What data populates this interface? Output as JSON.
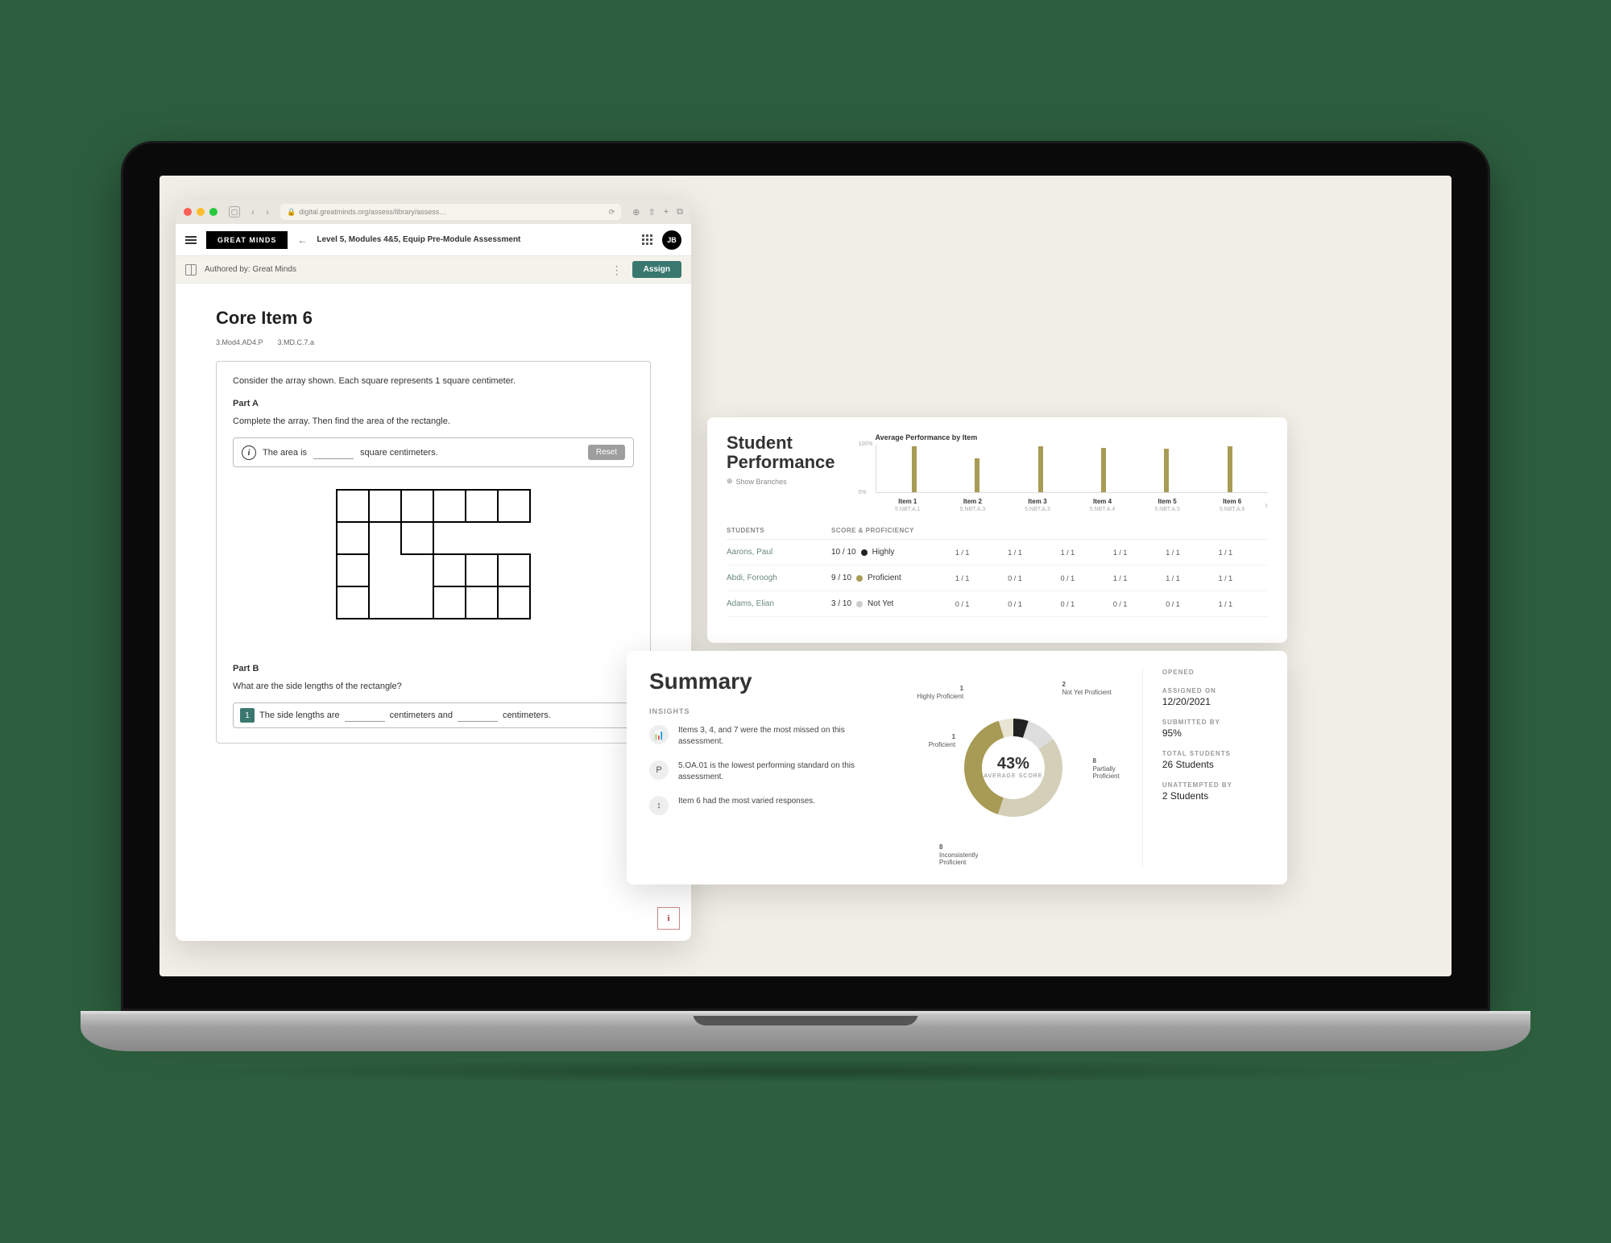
{
  "browser": {
    "url": "digital.greatminds.org/assess/library/assess…",
    "logo": "GREAT MINDS",
    "page_title": "Level 5, Modules 4&5, Equip Pre-Module Assessment",
    "avatar_initials": "JB",
    "authored_by_label": "Authored by: Great Minds",
    "assign_label": "Assign"
  },
  "item": {
    "title": "Core Item 6",
    "standards": [
      "3.Mod4.AD4.P",
      "3.MD.C.7.a"
    ],
    "prompt": "Consider the array shown. Each square represents 1 square centimeter.",
    "partA_label": "Part A",
    "partA_text": "Complete the array. Then find the area of the rectangle.",
    "answer_prefix": "The area is",
    "answer_suffix": "square centimeters.",
    "reset_label": "Reset",
    "partB_label": "Part B",
    "partB_text": "What are the side lengths of the rectangle?",
    "fill_num": "1",
    "fill_prefix": "The side lengths are",
    "fill_mid": "centimeters and",
    "fill_suffix": "centimeters."
  },
  "performance": {
    "title": "Student Performance",
    "show_branches": "Show Branches",
    "students_h": "STUDENTS",
    "score_h": "SCORE & PROFICIENCY",
    "rows": [
      {
        "name": "Aarons, Paul",
        "score": "10 / 10",
        "prof": "Highly",
        "color": "#222",
        "cells": [
          "1 / 1",
          "1 / 1",
          "1 / 1",
          "1 / 1",
          "1 / 1",
          "1 / 1"
        ]
      },
      {
        "name": "Abdi, Foroogh",
        "score": "9 / 10",
        "prof": "Proficient",
        "color": "#a89b55",
        "cells": [
          "1 / 1",
          "0 / 1",
          "0 / 1",
          "1 / 1",
          "1 / 1",
          "1 / 1"
        ]
      },
      {
        "name": "Adams, Elian",
        "score": "3 / 10",
        "prof": "Not Yet",
        "color": "#ccc",
        "cells": [
          "0 / 1",
          "0 / 1",
          "0 / 1",
          "0 / 1",
          "0 / 1",
          "1 / 1"
        ]
      }
    ]
  },
  "chart_data": {
    "type": "bar",
    "title": "Average Performance by Item",
    "categories": [
      "Item 1",
      "Item 2",
      "Item 3",
      "Item 4",
      "Item 5",
      "Item 6"
    ],
    "sub_categories": [
      "5.NBT.A.1",
      "5.NBT.A.3",
      "5.NBT.A.3",
      "5.NBT.A.4",
      "5.NBT.A.5",
      "5.NBT.A.6"
    ],
    "values": [
      95,
      70,
      95,
      92,
      90,
      95
    ],
    "ylim": [
      0,
      100
    ],
    "ylabel": "%"
  },
  "summary": {
    "title": "Summary",
    "insights_label": "INSIGHTS",
    "insights": [
      {
        "icon": "📊",
        "text": "Items 3, 4, and 7 were the most missed on this assessment."
      },
      {
        "icon": "P",
        "text": "5.OA.01 is the lowest performing standard on this assessment."
      },
      {
        "icon": "↕",
        "text": "Item 6 had the most varied responses."
      }
    ],
    "average_score": "43%",
    "average_label": "AVERAGE SCORE",
    "segments": [
      {
        "label": "Highly Proficient",
        "value": 1,
        "color": "#222"
      },
      {
        "label": "Not Yet Proficient",
        "value": 2,
        "color": "#ddd"
      },
      {
        "label": "Partially Proficient",
        "value": 8,
        "color": "#d4cfb8"
      },
      {
        "label": "Inconsistently Proficient",
        "value": 8,
        "color": "#a89b55"
      },
      {
        "label": "Proficient",
        "value": 1,
        "color": "#e8e5d5"
      }
    ],
    "stats": [
      {
        "k": "OPENED",
        "v": ""
      },
      {
        "k": "ASSIGNED ON",
        "v": "12/20/2021"
      },
      {
        "k": "SUBMITTED BY",
        "v": "95%"
      },
      {
        "k": "TOTAL STUDENTS",
        "v": "26 Students"
      },
      {
        "k": "UNATTEMPTED BY",
        "v": "2 Students"
      }
    ]
  }
}
